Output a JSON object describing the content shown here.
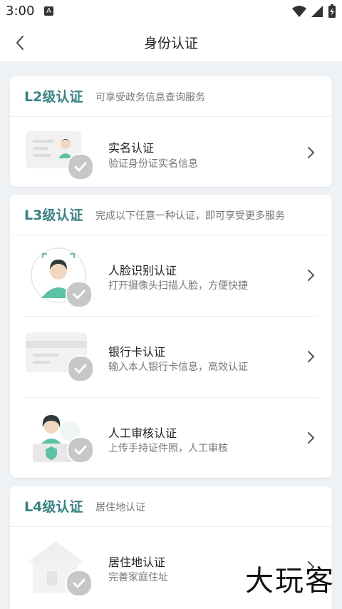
{
  "status_bar": {
    "time": "3:00",
    "notification_icon_letter": "A",
    "icons": [
      "wifi-icon",
      "signal-icon",
      "battery-charging-icon"
    ]
  },
  "header": {
    "title": "身份认证",
    "back_icon": "chevron-left-icon"
  },
  "sections": [
    {
      "level": "L2级认证",
      "description": "可享受政务信息查询服务",
      "items": [
        {
          "title": "实名认证",
          "subtitle": "验证身份证实名信息",
          "icon": "id-card-person-icon"
        }
      ]
    },
    {
      "level": "L3级认证",
      "description": "完成以下任意一种认证，即可享受更多服务",
      "items": [
        {
          "title": "人脸识别认证",
          "subtitle": "打开摄像头扫描人脸，方便快捷",
          "icon": "face-scan-icon"
        },
        {
          "title": "银行卡认证",
          "subtitle": "输入本人银行卡信息，高效认证",
          "icon": "bank-card-icon"
        },
        {
          "title": "人工审核认证",
          "subtitle": "上传手持证件照，人工审核",
          "icon": "manual-review-icon"
        }
      ]
    },
    {
      "level": "L4级认证",
      "description": "居住地认证",
      "items": [
        {
          "title": "居住地认证",
          "subtitle": "完善家庭住址",
          "icon": "house-icon"
        }
      ]
    }
  ],
  "watermark": "大玩客",
  "colors": {
    "accent": "#3a8083",
    "background": "#eef2f5",
    "check_gray": "#c7c7c7",
    "face_teal": "#5cc2a6"
  }
}
